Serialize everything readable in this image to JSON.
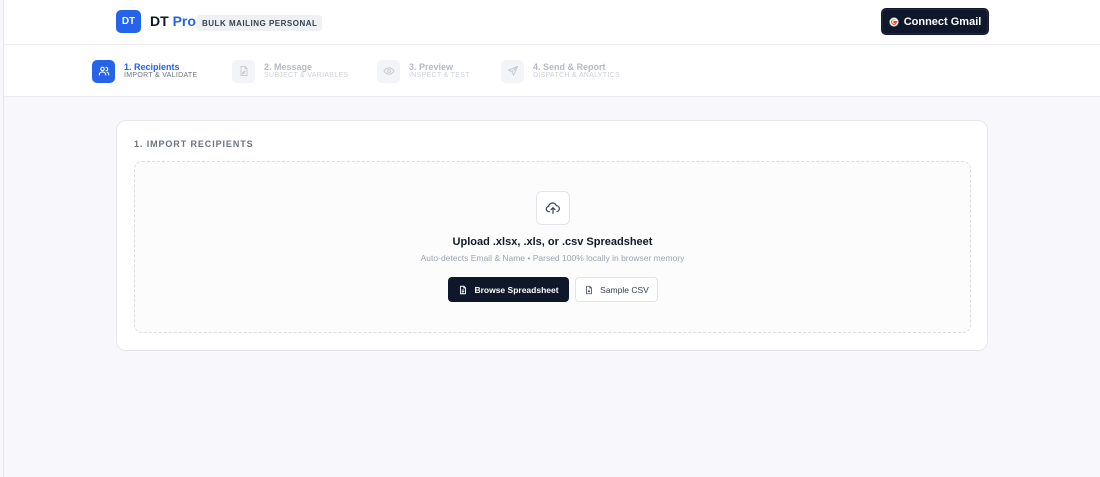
{
  "header": {
    "logo_text": "DT",
    "brand_name": "DT",
    "brand_suffix": "Pro",
    "brand_pill": "BULK MAILING PERSONAL",
    "connect_button_label": "Connect Gmail"
  },
  "stepper": {
    "steps": [
      {
        "title": "1. Recipients",
        "subtitle": "IMPORT & VALIDATE",
        "icon": "users-icon",
        "active": true
      },
      {
        "title": "2. Message",
        "subtitle": "SUBJECT & VARIABLES",
        "icon": "file-edit-icon",
        "active": false
      },
      {
        "title": "3. Preview",
        "subtitle": "INSPECT & TEST",
        "icon": "eye-icon",
        "active": false
      },
      {
        "title": "4. Send & Report",
        "subtitle": "DISPATCH & ANALYTICS",
        "icon": "send-icon",
        "active": false
      }
    ]
  },
  "import": {
    "section_title": "1. IMPORT RECIPIENTS",
    "upload_icon": "cloud-upload-icon",
    "upload_title": "Upload .xlsx, .xls, or .csv Spreadsheet",
    "upload_subtitle": "Auto-detects Email & Name • Parsed 100% locally in browser memory",
    "browse_button_label": "Browse Spreadsheet",
    "sample_button_label": "Sample CSV"
  },
  "colors": {
    "accent": "#2563eb",
    "dark": "#0f172a",
    "background": "#f8f8fc"
  }
}
